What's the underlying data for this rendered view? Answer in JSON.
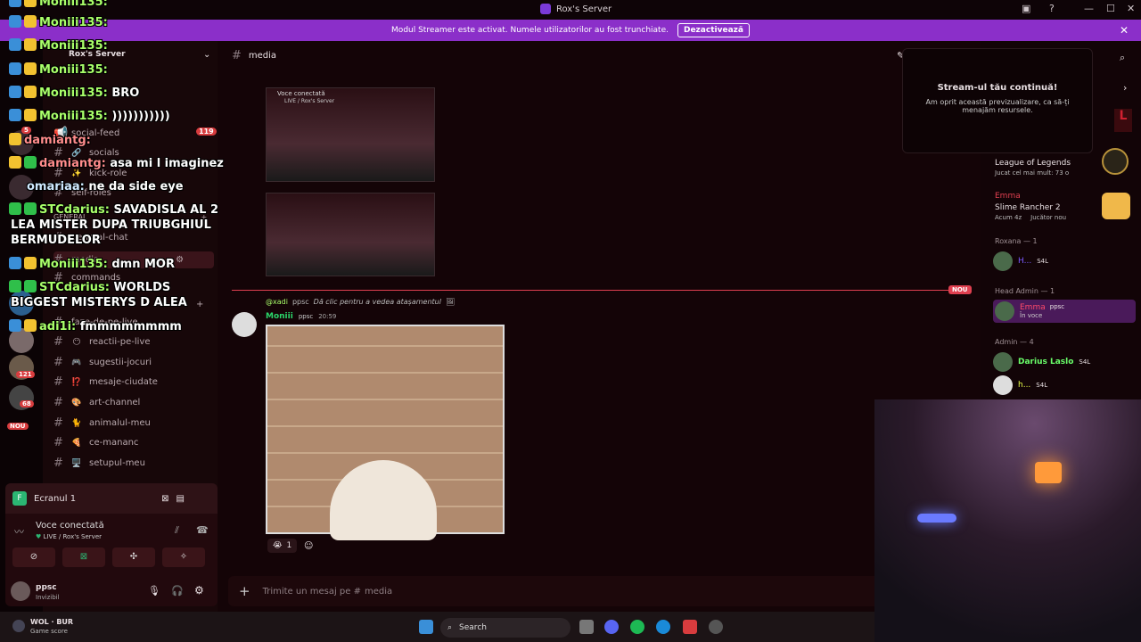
{
  "titlebar": {
    "title": "Rox's Server"
  },
  "banner": {
    "text": "Modul Streamer este activat. Numele utilizatorilor au fost trunchiate.",
    "button": "Dezactivează"
  },
  "serverbar": {
    "badges": [
      "121",
      "68",
      "NOU",
      "5",
      "119"
    ]
  },
  "channels": {
    "server_name": "Rox's Server",
    "items": [
      {
        "name": "social-feed",
        "emoji": ""
      },
      {
        "name": "socials",
        "emoji": "🔗"
      },
      {
        "name": "kick-role",
        "emoji": "✨"
      },
      {
        "name": "self-roles",
        "emoji": ""
      },
      {
        "name": "GENERAL",
        "emoji": ""
      },
      {
        "name": "general-chat",
        "emoji": ""
      },
      {
        "name": "media",
        "emoji": ""
      },
      {
        "name": "commands",
        "emoji": ""
      },
      {
        "name": "faze-de-pe-live",
        "emoji": ""
      },
      {
        "name": "reactii-pe-live",
        "emoji": "😶"
      },
      {
        "name": "sugestii-jocuri",
        "emoji": "🎮"
      },
      {
        "name": "mesaje-ciudate",
        "emoji": "⁉️"
      },
      {
        "name": "art-channel",
        "emoji": "🎨"
      },
      {
        "name": "animalul-meu",
        "emoji": "🐈"
      },
      {
        "name": "ce-mananc",
        "emoji": "🍕"
      },
      {
        "name": "setupul-meu",
        "emoji": "🖥️"
      }
    ],
    "unread": "119"
  },
  "voice": {
    "screen": "Ecranul 1",
    "status": "Voce conectată",
    "location": "LIVE / Rox's Server"
  },
  "user": {
    "name": "ppsc",
    "status": "Invizibil"
  },
  "main": {
    "channel": "media",
    "thumb_status": "Voce conectată",
    "thumb_location": "LIVE / Rox's Server",
    "new_label": "NOU",
    "reply_user": "@xadi",
    "reply_tag": "ppsc",
    "reply_text": "Dă clic pentru a vedea atașamentul",
    "author": "Moniii",
    "author_tag": "ppsc",
    "time": "20:59",
    "reaction_count": "1",
    "composer_placeholder": "Trimite un mesaj pe #",
    "composer_channel": "media"
  },
  "popup": {
    "title": "Stream-ul tău continuă!",
    "text": "Am oprit această previzualizare, ca să-ți menajăm resursele."
  },
  "members": {
    "game1": "League of Legends",
    "game1_sub": "Jucat cel mai mult: 73 o",
    "emma_name": "Emma",
    "game2": "Slime Rancher 2",
    "game2_sub": "Acum 4z",
    "game2_sub2": "Jucător nou",
    "group1": "Roxana — 1",
    "m1": "H...",
    "tag": "S4L",
    "group2": "Head Admin — 1",
    "m2": "Emma",
    "m2_tag": "ppsc",
    "m2_status": "În voce",
    "group3": "Admin — 4",
    "m3": "Darius Laslo",
    "m4": "h..."
  },
  "taskbar": {
    "game": "WOL · BUR",
    "game_sub": "Game score",
    "search": "Search"
  },
  "chat_overlay": [
    {
      "user": "Moniii135:",
      "msg": ""
    },
    {
      "user": "Moniii135:",
      "msg": ""
    },
    {
      "user": "Moniii135:",
      "msg": ""
    },
    {
      "user": "Moniii135:",
      "msg": ""
    },
    {
      "user": "Moniii135:",
      "msg": "BRO"
    },
    {
      "user": "Moniii135:",
      "msg": ")))))))))))"
    },
    {
      "user": "damiantg:",
      "msg": ""
    },
    {
      "user": "damiantg:",
      "msg": "asa mi l imaginez"
    },
    {
      "user": "omariaa:",
      "msg": "ne da side eye"
    },
    {
      "user": "STCdarius:",
      "msg": "SAVADISLA AL 2"
    },
    {
      "user": "",
      "msg": "LEA MISTER DUPA TRIUBGHIUL"
    },
    {
      "user": "",
      "msg": "BERMUDELOR"
    },
    {
      "user": "Moniii135:",
      "msg": "dmn MOR"
    },
    {
      "user": "STCdarius:",
      "msg": "WORLDS"
    },
    {
      "user": "",
      "msg": "BIGGEST MISTERYS D ALEA"
    },
    {
      "user": "adi1i:",
      "msg": "fmmmmmmmm"
    }
  ]
}
